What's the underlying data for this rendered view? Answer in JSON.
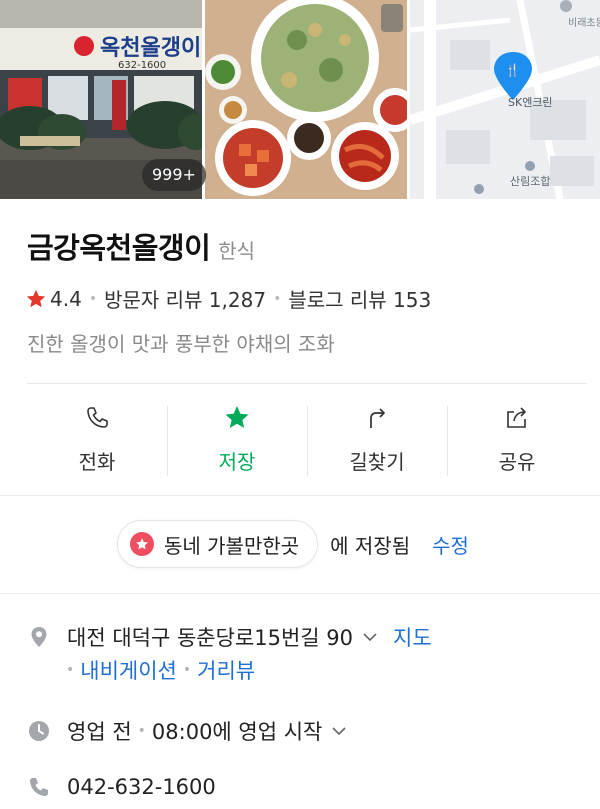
{
  "photos": {
    "count_badge": "999+",
    "sign_text": "옥천올갱이",
    "sign_phone": "632-1600",
    "map_labels": [
      "비래초등학교",
      "SK엔크린",
      "산림조합"
    ]
  },
  "place": {
    "name": "금강옥천올갱이",
    "category": "한식",
    "rating": "4.4",
    "visitor_reviews": "방문자 리뷰 1,287",
    "blog_reviews": "블로그 리뷰 153",
    "description": "진한 올갱이 맛과 풍부한 야채의 조화"
  },
  "actions": {
    "call": "전화",
    "save": "저장",
    "directions": "길찾기",
    "share": "공유"
  },
  "saved": {
    "folder": "동네 가볼만한곳",
    "suffix": "에 저장됨",
    "edit": "수정"
  },
  "info": {
    "address": "대전 대덕구 동춘당로15번길 90",
    "map_link": "지도",
    "navigation_link": "내비게이션",
    "streetview_link": "거리뷰",
    "hours_status": "영업 전",
    "hours_detail": "08:00에 영업 시작",
    "phone": "042-632-1600"
  },
  "colors": {
    "accent_green": "#03aa5a",
    "link_blue": "#1f6fd6",
    "star_red": "#e5362c",
    "pin_blue": "#1f8ef1"
  }
}
